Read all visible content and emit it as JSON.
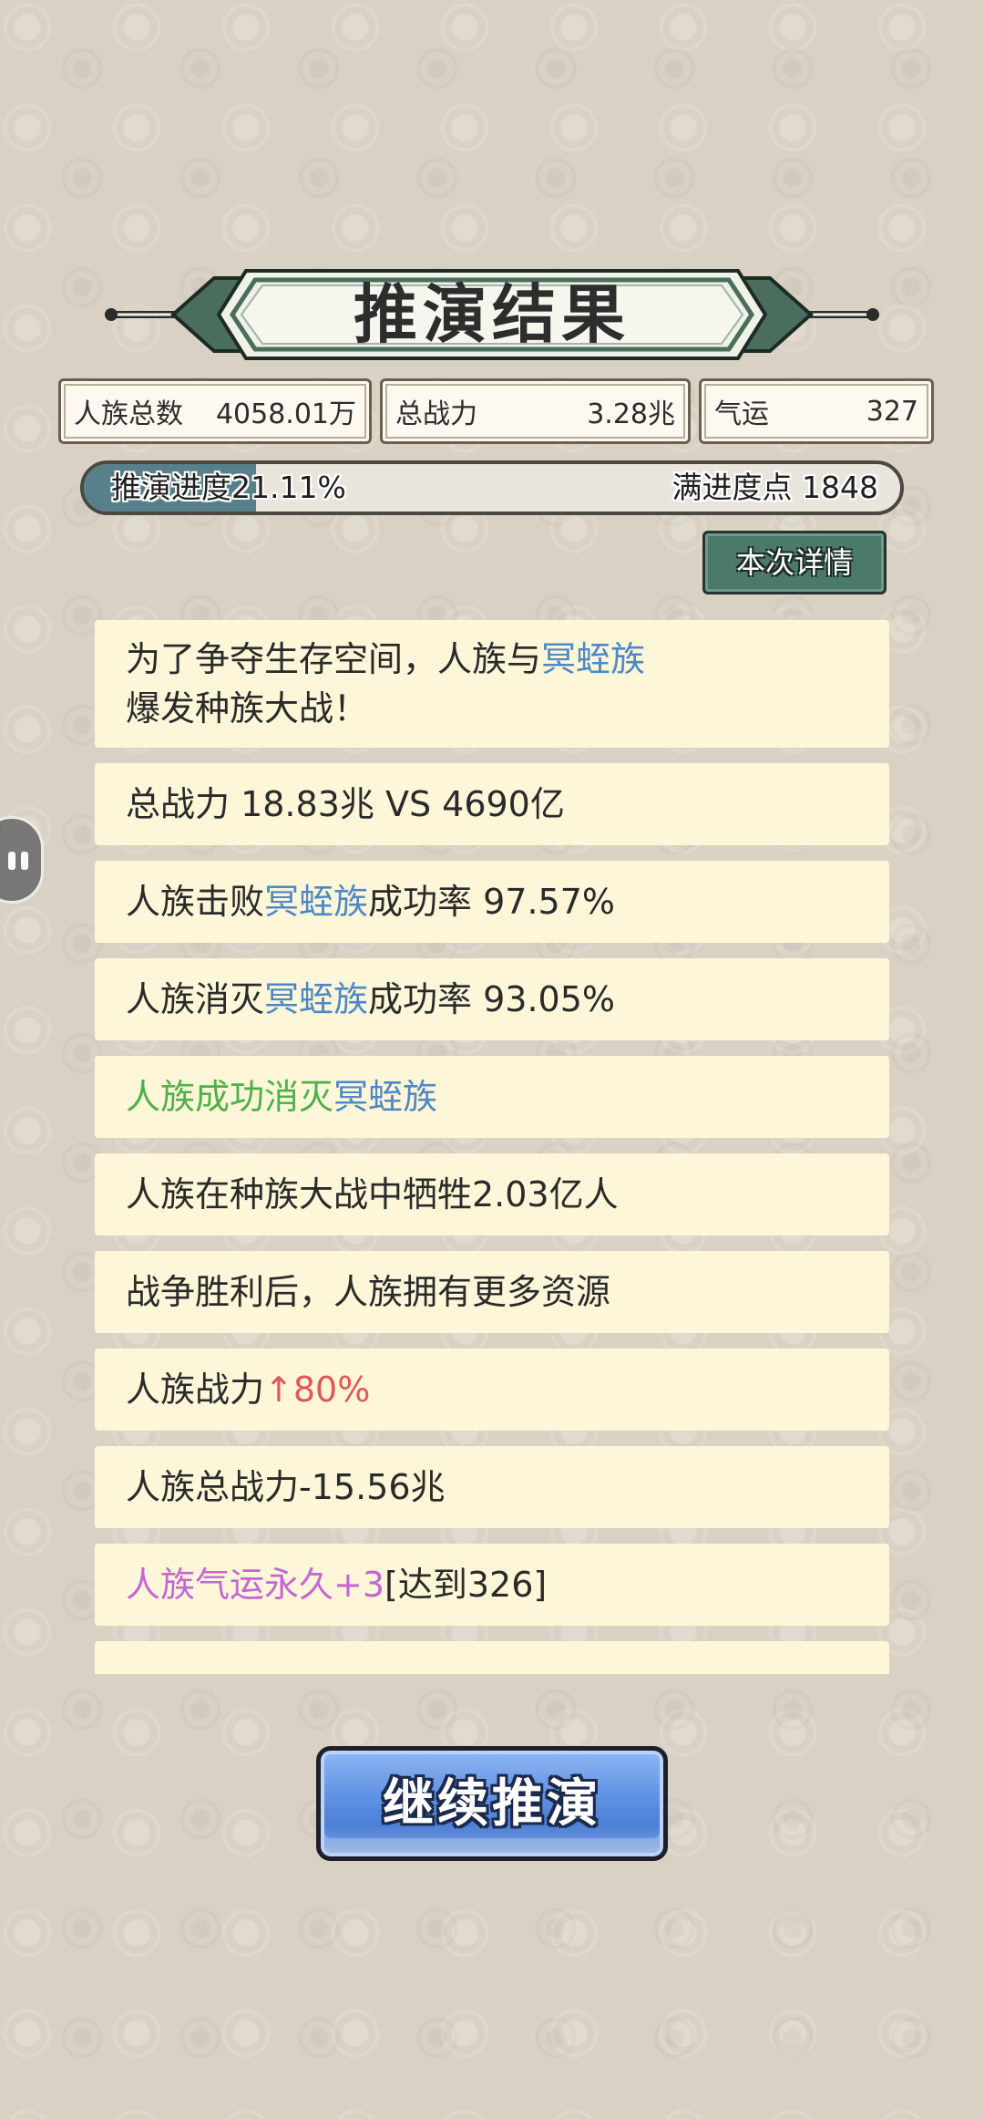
{
  "header": {
    "title": "推演结果"
  },
  "stats": [
    {
      "label": "人族总数",
      "value": "4058.01万"
    },
    {
      "label": "总战力",
      "value": "3.28兆"
    },
    {
      "label": "气运",
      "value": "327"
    }
  ],
  "progress": {
    "label": "推演进度21.11%",
    "fraction": 0.2111,
    "max_label": "满进度点 1848"
  },
  "details_button": {
    "label": "本次详情"
  },
  "results": [
    {
      "parts": [
        {
          "text": "为了争夺生存空间，人族与",
          "color": "default"
        },
        {
          "text": "冥蛭族",
          "color": "blue"
        },
        {
          "text": "爆发种族大战！",
          "color": "default"
        }
      ]
    },
    {
      "parts": [
        {
          "text": "总战力 18.83兆 VS 4690亿",
          "color": "default"
        }
      ]
    },
    {
      "parts": [
        {
          "text": "人族击败",
          "color": "default"
        },
        {
          "text": "冥蛭族",
          "color": "blue"
        },
        {
          "text": "成功率 97.57%",
          "color": "default"
        }
      ]
    },
    {
      "parts": [
        {
          "text": "人族消灭",
          "color": "default"
        },
        {
          "text": "冥蛭族",
          "color": "blue"
        },
        {
          "text": "成功率 93.05%",
          "color": "default"
        }
      ]
    },
    {
      "parts": [
        {
          "text": "人族成功消灭",
          "color": "green"
        },
        {
          "text": "冥蛭族",
          "color": "blue"
        }
      ]
    },
    {
      "parts": [
        {
          "text": "人族在种族大战中牺牲2.03亿人",
          "color": "default"
        }
      ]
    },
    {
      "parts": [
        {
          "text": "战争胜利后，人族拥有更多资源",
          "color": "default"
        }
      ]
    },
    {
      "parts": [
        {
          "text": "人族战力",
          "color": "default"
        },
        {
          "text": "↑80%",
          "color": "red"
        }
      ]
    },
    {
      "parts": [
        {
          "text": "人族总战力-15.56兆",
          "color": "default"
        }
      ]
    },
    {
      "parts": [
        {
          "text": "人族气运永久+3",
          "color": "purple"
        },
        {
          "text": "[达到326]",
          "color": "default"
        }
      ]
    },
    {
      "parts": [
        {
          "text": "",
          "color": "default"
        }
      ]
    }
  ],
  "continue_button": {
    "label": "继续推演"
  },
  "colors": {
    "blue": "#4e88c5",
    "green": "#4fb04a",
    "red": "#e05858",
    "purple": "#c566d6",
    "banner": "#4b6d5e"
  }
}
